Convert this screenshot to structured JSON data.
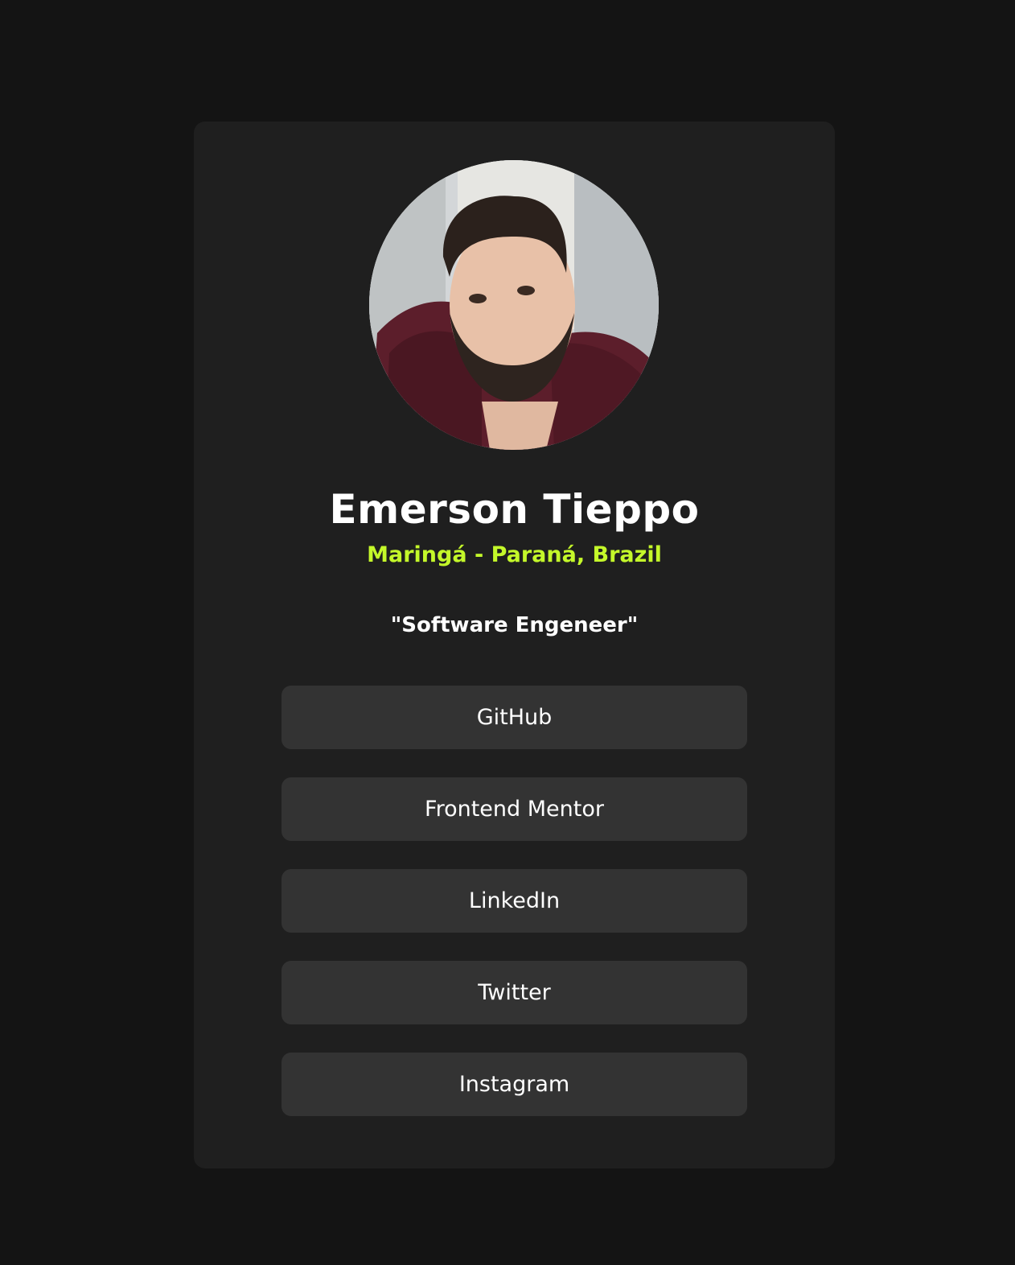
{
  "profile": {
    "avatar_alt": "profile photo",
    "name": "Emerson Tieppo",
    "location": "Maringá - Paraná, Brazil",
    "bio": "\"Software Engeneer\""
  },
  "links": [
    {
      "label": "GitHub"
    },
    {
      "label": "Frontend Mentor"
    },
    {
      "label": "LinkedIn"
    },
    {
      "label": "Twitter"
    },
    {
      "label": "Instagram"
    }
  ],
  "colors": {
    "page_background": "#141414",
    "card_background": "#1f1f1f",
    "button_background": "#333333",
    "accent": "#c4f82a",
    "text": "#ffffff"
  }
}
